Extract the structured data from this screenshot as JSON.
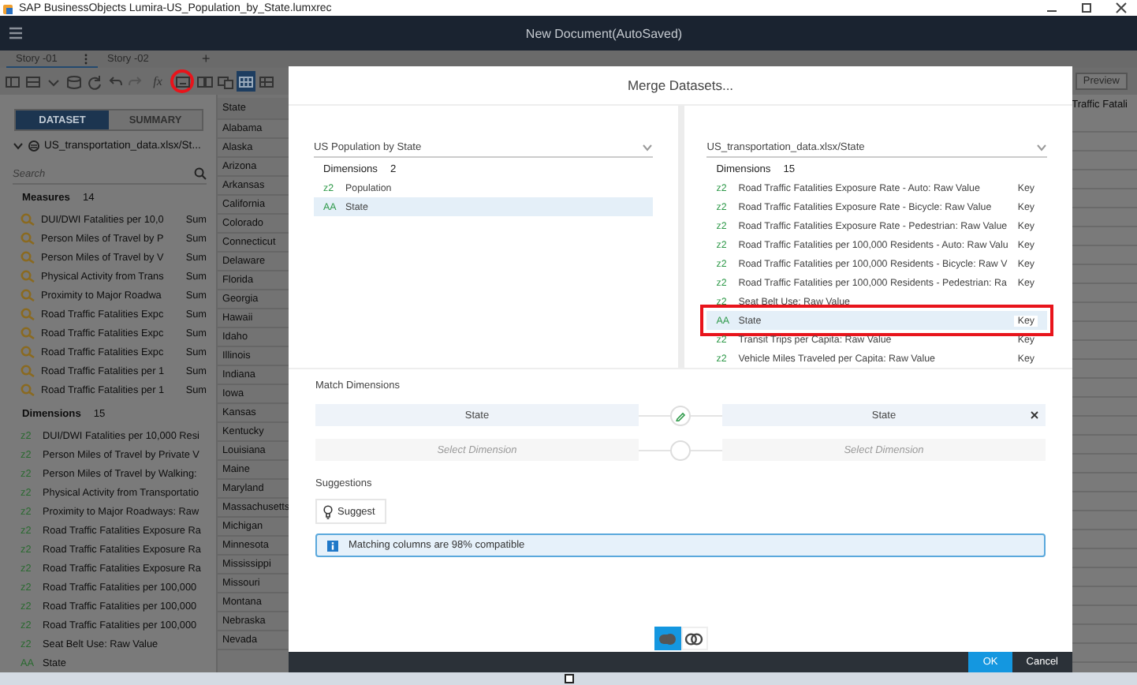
{
  "window": {
    "title": "SAP BusinessObjects Lumira-US_Population_by_State.lumxrec"
  },
  "app_bar": {
    "title": "New Document(AutoSaved)"
  },
  "story_tabs": [
    {
      "label": "Story -01",
      "selected": true
    },
    {
      "label": "Story -02",
      "selected": false
    }
  ],
  "add_tab": "+",
  "toolbar": [
    {
      "kind": "panel",
      "selected": false,
      "highlighted": false
    },
    {
      "kind": "table",
      "selected": false,
      "highlighted": false
    },
    {
      "kind": "chevron",
      "selected": false,
      "highlighted": false
    },
    {
      "kind": "database",
      "selected": false,
      "highlighted": false
    },
    {
      "kind": "refresh",
      "selected": false,
      "highlighted": false
    },
    {
      "kind": "undo",
      "selected": false,
      "highlighted": false
    },
    {
      "kind": "redo",
      "selected": false,
      "highlighted": false
    },
    {
      "kind": "formula",
      "label": "fx",
      "selected": false,
      "highlighted": false
    },
    {
      "kind": "merge",
      "selected": false,
      "highlighted": true
    },
    {
      "kind": "split",
      "selected": false,
      "highlighted": false
    },
    {
      "kind": "compare",
      "selected": false,
      "highlighted": false
    },
    {
      "kind": "grid",
      "selected": true,
      "highlighted": false
    },
    {
      "kind": "columns",
      "selected": false,
      "highlighted": false
    }
  ],
  "preview_button": "Preview",
  "view_toggle": [
    {
      "label": "DATASET",
      "selected": true
    },
    {
      "label": "SUMMARY",
      "selected": false
    }
  ],
  "dataset": "US_transportation_data.xlsx/St...",
  "search": {
    "placeholder": "Search"
  },
  "measures": {
    "label": "Measures",
    "count": "14",
    "items": [
      {
        "name": "DUI/DWI Fatalities per 10,0",
        "aggregation": "Sum"
      },
      {
        "name": "Person Miles of Travel by P",
        "aggregation": "Sum"
      },
      {
        "name": "Person Miles of Travel by V",
        "aggregation": "Sum"
      },
      {
        "name": "Physical Activity from Trans",
        "aggregation": "Sum"
      },
      {
        "name": "Proximity to Major Roadwa",
        "aggregation": "Sum"
      },
      {
        "name": "Road Traffic Fatalities Expc",
        "aggregation": "Sum"
      },
      {
        "name": "Road Traffic Fatalities Expc",
        "aggregation": "Sum"
      },
      {
        "name": "Road Traffic Fatalities Expc",
        "aggregation": "Sum"
      },
      {
        "name": "Road Traffic Fatalities per 1",
        "aggregation": "Sum"
      },
      {
        "name": "Road Traffic Fatalities per 1",
        "aggregation": "Sum"
      }
    ]
  },
  "dimensions": {
    "label": "Dimensions",
    "count": "15",
    "items": [
      {
        "glyph": "z2",
        "name": "DUI/DWI Fatalities per 10,000 Resi"
      },
      {
        "glyph": "z2",
        "name": "Person Miles of Travel by Private V"
      },
      {
        "glyph": "z2",
        "name": "Person Miles of Travel by Walking:"
      },
      {
        "glyph": "z2",
        "name": "Physical Activity from Transportatio"
      },
      {
        "glyph": "z2",
        "name": "Proximity to Major Roadways: Raw"
      },
      {
        "glyph": "z2",
        "name": "Road Traffic Fatalities Exposure Ra"
      },
      {
        "glyph": "z2",
        "name": "Road Traffic Fatalities Exposure Ra"
      },
      {
        "glyph": "z2",
        "name": "Road Traffic Fatalities Exposure Ra"
      },
      {
        "glyph": "z2",
        "name": "Road Traffic Fatalities per 100,000"
      },
      {
        "glyph": "z2",
        "name": "Road Traffic Fatalities per 100,000"
      },
      {
        "glyph": "z2",
        "name": "Road Traffic Fatalities per 100,000"
      },
      {
        "glyph": "z2",
        "name": "Seat Belt Use: Raw Value"
      },
      {
        "glyph": "AA",
        "name": "State"
      }
    ]
  },
  "table": {
    "header": "State",
    "rows": [
      "Alabama",
      "Alaska",
      "Arizona",
      "Arkansas",
      "California",
      "Colorado",
      "Connecticut",
      "Delaware",
      "Florida",
      "Georgia",
      "Hawaii",
      "Idaho",
      "Illinois",
      "Indiana",
      "Iowa",
      "Kansas",
      "Kentucky",
      "Louisiana",
      "Maine",
      "Maryland",
      "Massachusetts",
      "Michigan",
      "Minnesota",
      "Mississippi",
      "Missouri",
      "Montana",
      "Nebraska",
      "Nevada"
    ],
    "column_2_header": "Traffic Fatali"
  },
  "dialog": {
    "title": "Merge Datasets...",
    "left": {
      "dataset": "US Population by State",
      "label": "Dimensions",
      "count": "2",
      "items": [
        {
          "glyph": "z2",
          "name": "Population",
          "selected": false
        },
        {
          "glyph": "AA",
          "name": "State",
          "selected": true
        }
      ]
    },
    "right": {
      "dataset": "US_transportation_data.xlsx/State",
      "label": "Dimensions",
      "count": "15",
      "items": [
        {
          "glyph": "z2",
          "name": "Road Traffic Fatalities Exposure Rate - Auto: Raw Value",
          "key": "Key",
          "selected": false,
          "highlighted": false
        },
        {
          "glyph": "z2",
          "name": "Road Traffic Fatalities Exposure Rate - Bicycle: Raw Value",
          "key": "Key",
          "selected": false,
          "highlighted": false
        },
        {
          "glyph": "z2",
          "name": "Road Traffic Fatalities Exposure Rate - Pedestrian: Raw Value",
          "key": "Key",
          "selected": false,
          "highlighted": false
        },
        {
          "glyph": "z2",
          "name": "Road Traffic Fatalities per 100,000 Residents - Auto: Raw Valu",
          "key": "Key",
          "selected": false,
          "highlighted": false
        },
        {
          "glyph": "z2",
          "name": "Road Traffic Fatalities per 100,000 Residents - Bicycle: Raw V",
          "key": "Key",
          "selected": false,
          "highlighted": false
        },
        {
          "glyph": "z2",
          "name": "Road Traffic Fatalities per 100,000 Residents - Pedestrian: Ra",
          "key": "Key",
          "selected": false,
          "highlighted": false
        },
        {
          "glyph": "z2",
          "name": "Seat Belt Use: Raw Value",
          "selected": false,
          "highlighted": false
        },
        {
          "glyph": "AA",
          "name": "State",
          "key": "Key",
          "selected": true,
          "highlighted": true
        },
        {
          "glyph": "z2",
          "name": "Transit Trips per Capita: Raw Value",
          "key": "Key",
          "selected": false,
          "highlighted": false
        },
        {
          "glyph": "z2",
          "name": "Vehicle Miles Traveled per Capita: Raw Value",
          "key": "Key",
          "selected": false,
          "highlighted": false
        }
      ]
    },
    "match_label": "Match Dimensions",
    "matches": [
      {
        "left": "State",
        "right": "State",
        "linked": true,
        "removable": true
      },
      {
        "left_placeholder": "Select Dimension",
        "right_placeholder": "Select Dimension",
        "linked": false,
        "removable": false
      }
    ],
    "suggestions_label": "Suggestions",
    "suggest_button": "Suggest",
    "info": "Matching columns are 98% compatible",
    "merge_modes": [
      {
        "kind": "join",
        "selected": true
      },
      {
        "kind": "union",
        "selected": false
      }
    ],
    "buttons": [
      {
        "label": "OK",
        "kind": "primary"
      },
      {
        "label": "Cancel",
        "kind": "secondary"
      }
    ]
  }
}
